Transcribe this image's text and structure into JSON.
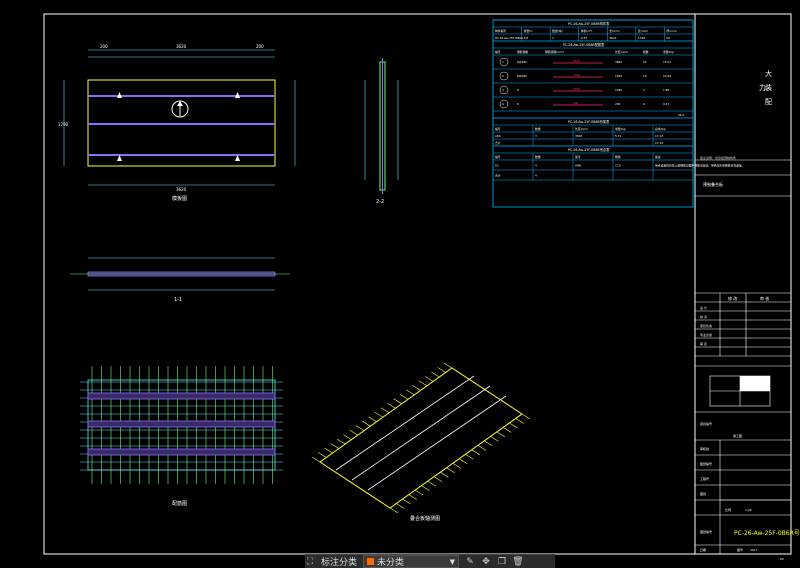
{
  "drawing": {
    "title_block": {
      "big_chars": [
        "大",
        "力",
        "装",
        "配"
      ],
      "designer_row": "预制叠合板",
      "designer_small": "备注说明：叠合板预制构件",
      "rev_a": "修 改",
      "rev_b": "审 核",
      "scale_label": "比例",
      "scale_value": "1:25",
      "date_label": "日期",
      "date_value": "2017",
      "sheet_label": "图号",
      "drawing_no": "PC-26-Aw-25F-0B6R号",
      "left_labels": [
        "设 计",
        "校 对",
        "项目负责",
        "专业负责",
        "审 定"
      ],
      "bottom_labels": [
        "审核批",
        "图纸编号",
        "工程号",
        "图别",
        "图纸编号"
      ],
      "footer_left": "项目编号",
      "footer_mid": "施工图",
      "page_no": "02"
    },
    "table1": {
      "title": "PC-26-Aw-25F-0B6R构件表",
      "headers": [
        "构件编号",
        "重量(t)",
        "数量(块)",
        "体积(m³)",
        "长(mm)",
        "宽(mm)",
        "厚(mm)"
      ],
      "row": [
        "PC-26-Aw-25F-0B6R",
        "0.8",
        "1",
        "0.33",
        "3620",
        "1790",
        "60"
      ]
    },
    "table2": {
      "title": "PC-26-Aw-25F-0B6R配筋表",
      "headers": [
        "编号",
        "钢筋规格",
        "钢筋简图(mm)",
        "长度(mm)",
        "根数",
        "重量(kg)"
      ],
      "rows": [
        [
          "1",
          "8@200",
          "3620",
          "3800",
          "10",
          "15.01"
        ],
        [
          "2",
          "8@200",
          "1790",
          "1950",
          "19",
          "14.64"
        ],
        [
          "3",
          "8",
          "1560",
          "1560",
          "3",
          "1.85"
        ],
        [
          "4",
          "8",
          "200",
          "200",
          "6",
          "0.47"
        ]
      ],
      "total": "32.0"
    },
    "table3": {
      "title": "PC-26-Aw-25F-0B6R桁架表",
      "headers": [
        "编号",
        "数量",
        "长度(mm)",
        "重量(kg)",
        "总重(kg)"
      ],
      "rows": [
        [
          "A80",
          "3",
          "3500",
          "5.71",
          "17.13"
        ],
        [
          "合计",
          "",
          "",
          "",
          "17.13"
        ]
      ]
    },
    "table4": {
      "title": "PC-26-Aw-25F-0B6R吊点表",
      "headers": [
        "编号",
        "数量",
        "型号",
        "规格",
        "备注"
      ],
      "rows": [
        [
          "D1",
          "4",
          "HRB",
          "C10",
          "吊点设置在桁架上弦钢筋与腹杆钢筋交接处，吊钩与桁架钢筋可靠连接。"
        ],
        [
          "合计",
          "4",
          "",
          "",
          ""
        ]
      ]
    },
    "views": {
      "plan_label": "模板图",
      "section11_label": "1-1",
      "section22_label": "2-2",
      "rebar_label": "配筋图",
      "iso_label": "叠合板轴测图",
      "plan_dim_total": "3620",
      "plan_dim_width": "1790",
      "plan_dim_side": "200"
    },
    "colors": {
      "frame": "#ffffff",
      "table_line": "#00b7ff",
      "highlight": "#ff2a6d",
      "slab_purple": "#8c6cff",
      "rebar_green": "#6fff6f",
      "rebar_cyan": "#54e6ff",
      "iso_yellow": "#ffff33",
      "drawing_no_color": "#ffff00"
    }
  },
  "toolbar": {
    "icon_hierarchy": "hierarchy-icon",
    "label_class": "标注分类",
    "select_value": "未分类",
    "icons": [
      "edit-icon",
      "move-icon",
      "copy-icon",
      "delete-icon"
    ]
  }
}
